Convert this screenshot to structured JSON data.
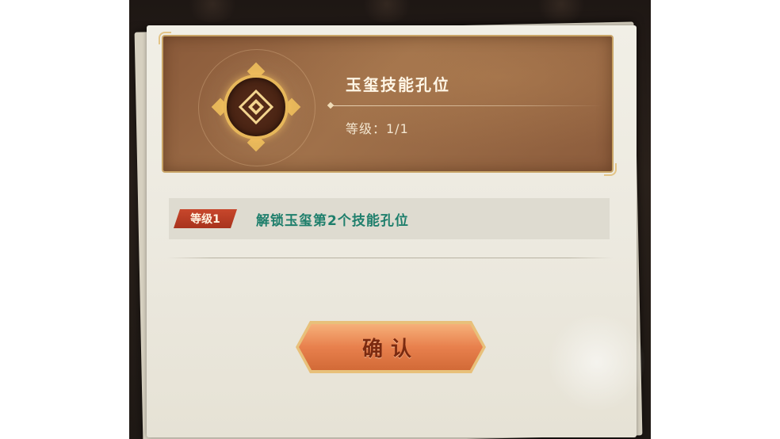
{
  "dialog": {
    "title": "玉玺技能孔位",
    "level_line": "等级：1/1",
    "emblem_icon": "jade-seal-skill-slot-icon"
  },
  "effects": [
    {
      "badge": "等级1",
      "description": "解锁玉玺第2个技能孔位"
    }
  ],
  "confirm_label": "确认",
  "colors": {
    "effect_text": "#1f7f6c",
    "badge": "#c8472c",
    "button": "#e8804d",
    "header_card": "#8a5a3a"
  }
}
